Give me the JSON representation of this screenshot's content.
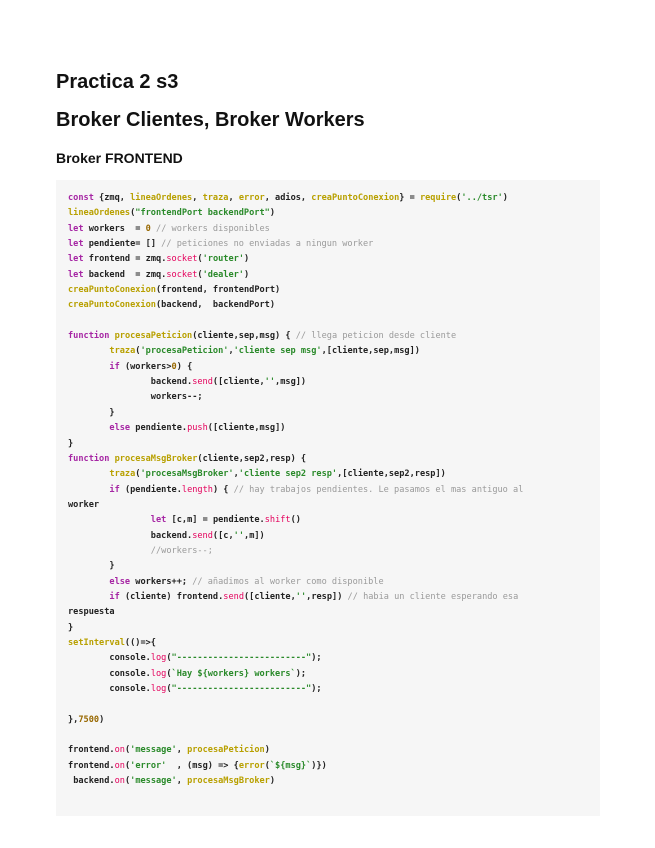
{
  "document": {
    "title": "Practica 2 s3",
    "subtitle": "Broker Clientes, Broker Workers",
    "section": "Broker FRONTEND"
  },
  "code_lines": [
    "const {zmq, lineaOrdenes, traza, error, adios, creaPuntoConexion} = require('../tsr')",
    "lineaOrdenes(\"frontendPort backendPort\")",
    "let workers  = 0 // workers disponibles",
    "let pendiente= [] // peticiones no enviadas a ningun worker",
    "let frontend = zmq.socket('router')",
    "let backend  = zmq.socket('dealer')",
    "creaPuntoConexion(frontend, frontendPort)",
    "creaPuntoConexion(backend,  backendPort)",
    "",
    "function procesaPeticion(cliente,sep,msg) { // llega peticion desde cliente",
    "        traza('procesaPeticion','cliente sep msg',[cliente,sep,msg])",
    "        if (workers>0) {",
    "                backend.send([cliente,'',msg])",
    "                workers--;",
    "        }",
    "        else pendiente.push([cliente,msg])",
    "}",
    "function procesaMsgBroker(cliente,sep2,resp) {",
    "        traza('procesaMsgBroker','cliente sep2 resp',[cliente,sep2,resp])",
    "        if (pendiente.length) { // hay trabajos pendientes. Le pasamos el mas antiguo al",
    "worker",
    "                let [c,m] = pendiente.shift()",
    "                backend.send([c,'',m])",
    "                //workers--;",
    "        }",
    "        else workers++; // añadimos al worker como disponible",
    "        if (cliente) frontend.send([cliente,'',resp]) // habia un cliente esperando esa",
    "respuesta",
    "}",
    "setInterval(()=>{",
    "        console.log(\"-------------------------\");",
    "        console.log(`Hay ${workers} workers`);",
    "        console.log(\"-------------------------\");",
    "",
    "},7500)",
    "",
    "frontend.on('message', procesaPeticion)",
    "frontend.on('error'  , (msg) => {error(`${msg}`)})",
    " backend.on('message', procesaMsgBroker)"
  ]
}
